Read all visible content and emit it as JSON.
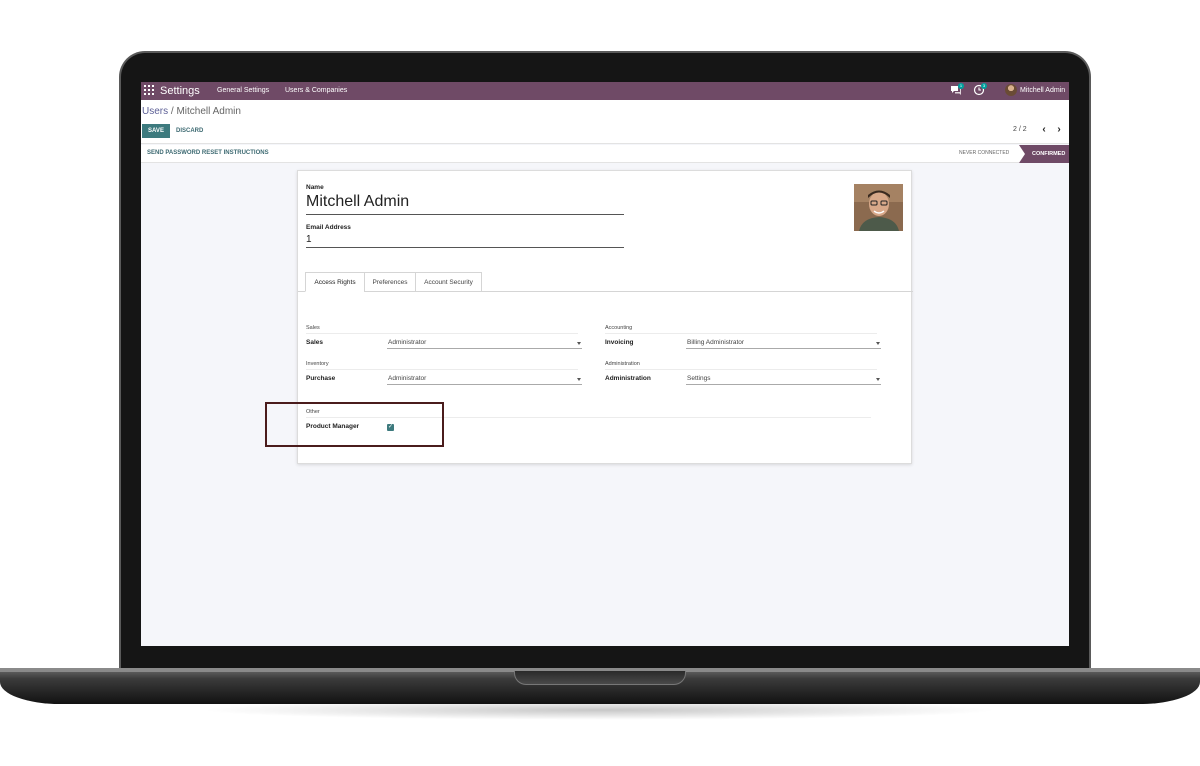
{
  "topbar": {
    "app_title": "Settings",
    "menu": [
      "General Settings",
      "Users & Companies"
    ],
    "chat_badge": "1",
    "activity_badge": "3",
    "user_name": "Mitchell Admin"
  },
  "control_panel": {
    "breadcrumb_parent": "Users",
    "breadcrumb_sep": " / ",
    "breadcrumb_current": "Mitchell Admin",
    "save_label": "SAVE",
    "discard_label": "DISCARD",
    "pager": "2 / 2"
  },
  "status_bar": {
    "reset_link": "SEND PASSWORD RESET INSTRUCTIONS",
    "stage_never": "NEVER CONNECTED",
    "stage_confirmed": "CONFIRMED"
  },
  "form": {
    "name_label": "Name",
    "name_value": "Mitchell Admin",
    "email_label": "Email Address",
    "email_value": "1"
  },
  "tabs": [
    "Access Rights",
    "Preferences",
    "Account Security"
  ],
  "access_rights": {
    "sales_group": "Sales",
    "sales_label": "Sales",
    "sales_value": "Administrator",
    "inventory_group": "Inventory",
    "purchase_label": "Purchase",
    "purchase_value": "Administrator",
    "accounting_group": "Accounting",
    "invoicing_label": "Invoicing",
    "invoicing_value": "Billing Administrator",
    "administration_group": "Administration",
    "administration_label": "Administration",
    "administration_value": "Settings",
    "other_group": "Other",
    "product_manager_label": "Product Manager",
    "product_manager_checked": true
  },
  "colors": {
    "brand": "#6f4a66",
    "primary_button": "#3d7a7e",
    "highlight_box": "#4a1c1c"
  }
}
